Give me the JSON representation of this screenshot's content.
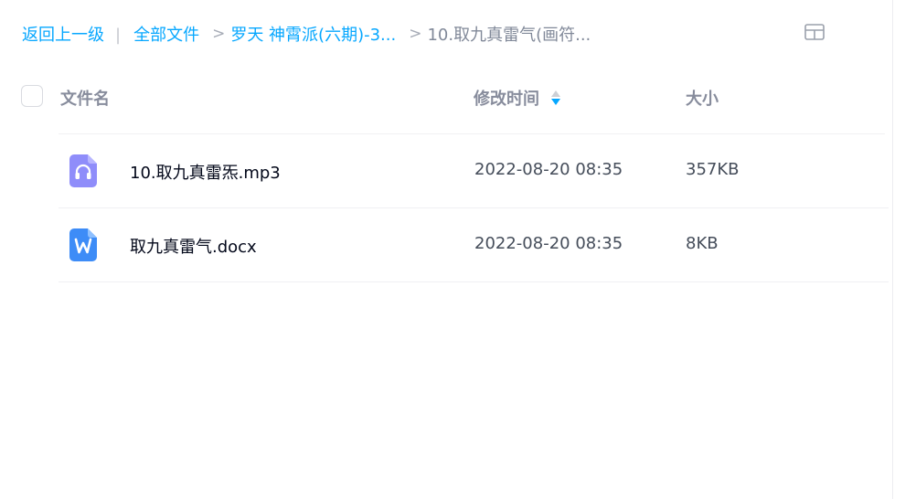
{
  "breadcrumb": {
    "back_label": "返回上一级",
    "divider": "|",
    "items": [
      {
        "label": "全部文件"
      },
      {
        "label": "罗天 神霄派(六期)-3..."
      },
      {
        "label": "10.取九真雷气(画符..."
      }
    ],
    "separator": ">"
  },
  "toolbar": {
    "view_toggle_icon": "grid-view-icon"
  },
  "table": {
    "columns": {
      "name": "文件名",
      "modified": "修改时间",
      "size": "大小"
    },
    "sort_icon": "sort-icon",
    "rows": [
      {
        "icon": "audio-file-icon",
        "name": "10.取九真雷炁.mp3",
        "modified": "2022-08-20 08:35",
        "size": "357KB"
      },
      {
        "icon": "word-file-icon",
        "name": "取九真雷气.docx",
        "modified": "2022-08-20 08:35",
        "size": "8KB"
      }
    ]
  },
  "colors": {
    "link": "#06a7ff",
    "audio_icon": "#8f8dfa",
    "word_icon": "#3d8cf7",
    "text_primary": "#03081a",
    "text_secondary": "#454d5a",
    "header_text": "#878c9c"
  }
}
